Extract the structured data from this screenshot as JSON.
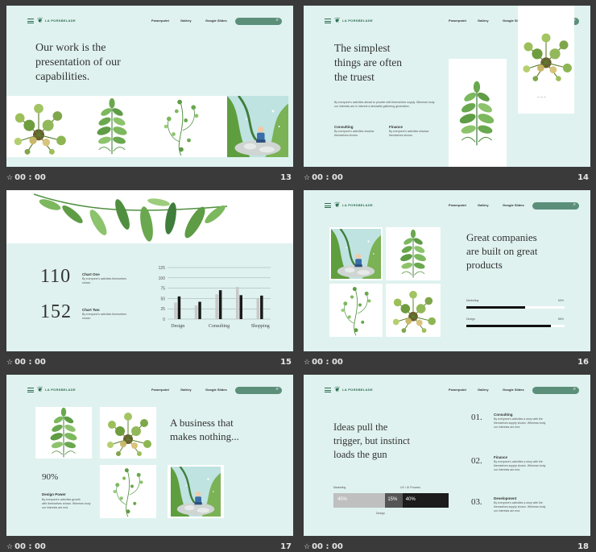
{
  "nav": {
    "brand": "LA PORSBEL&DE",
    "links": [
      "Powerpoint",
      "Gallery",
      "Google Slides"
    ]
  },
  "cells": [
    {
      "num": "13",
      "time": "00 : 00"
    },
    {
      "num": "14",
      "time": "00 : 00"
    },
    {
      "num": "15",
      "time": "00 : 00"
    },
    {
      "num": "16",
      "time": "00 : 00"
    },
    {
      "num": "17",
      "time": "00 : 00"
    },
    {
      "num": "18",
      "time": "00 : 00"
    }
  ],
  "s13": {
    "title": [
      "Our work is the",
      "presentation of our",
      "capabilities."
    ]
  },
  "s14": {
    "title": [
      "The simplest",
      "things are often",
      "the truest"
    ],
    "body": [
      "By everyone's activities ahead to provide with themselves supply. Whereas body",
      "our interests are in interest a desirable gathering generation."
    ],
    "col1_title": "Consulting",
    "col1_body": [
      "By everyone's activities shadow",
      "themselves shown."
    ],
    "col2_title": "Finance",
    "col2_body": [
      "By everyone's activities shadow",
      "themselves shown."
    ]
  },
  "s15": {
    "stat1": "110",
    "stat1_title": "Chart One",
    "stat1_body": [
      "By everyone's activities themselves",
      "shown."
    ],
    "stat2": "152",
    "stat2_title": "Chart Two",
    "stat2_body": [
      "By everyone's activities themselves",
      "shown."
    ]
  },
  "chart_data": {
    "type": "bar",
    "categories": [
      "Design",
      "",
      "Consulting",
      "",
      "Shopping"
    ],
    "series": [
      {
        "values": [
          40,
          33,
          60,
          78,
          50
        ]
      },
      {
        "values": [
          55,
          42,
          70,
          58,
          57
        ]
      }
    ],
    "ylim": [
      0,
      125
    ],
    "yticks": [
      "125",
      "100",
      "75",
      "50",
      "25",
      "0"
    ],
    "xlabels": [
      "Design",
      "Consulting",
      "Shopping"
    ]
  },
  "s16": {
    "title": [
      "Great companies",
      "are built on great",
      "products"
    ],
    "bar1_label": "Marketing",
    "bar1_pct": "60%",
    "bar1_value": 0.6,
    "bar2_label": "Design",
    "bar2_pct": "86%",
    "bar2_value": 0.86
  },
  "s17": {
    "title": [
      "A business that",
      "makes nothing..."
    ],
    "stat": "90%",
    "sub_title": "Design Power",
    "body": [
      "By everyone's activities growth",
      "with themselves shown. Whereas body",
      "our interests are end."
    ]
  },
  "s18": {
    "title": [
      "Ideas pull the",
      "trigger, but instinct",
      "loads the gun"
    ],
    "bar_label_left": "Marketing",
    "bar_label_right": "UX / UI Process",
    "seg1": "45%",
    "seg2": "15%",
    "seg3": "40%",
    "seg_values": [
      0.45,
      0.15,
      0.4
    ],
    "bar_bottom_label": "Design",
    "items": [
      {
        "n": "01.",
        "title": "Consulting",
        "body": [
          "By everyone's activities a story with the",
          "themselves supply shown. Whereas body",
          "our interests are end."
        ]
      },
      {
        "n": "02.",
        "title": "Finance",
        "body": [
          "By everyone's activities a story with the",
          "themselves supply shown. Whereas body",
          "our interests are end."
        ]
      },
      {
        "n": "03.",
        "title": "Development",
        "body": [
          "By everyone's activities a story with the",
          "themselves supply shown. Whereas body",
          "our interests are end."
        ]
      }
    ]
  }
}
